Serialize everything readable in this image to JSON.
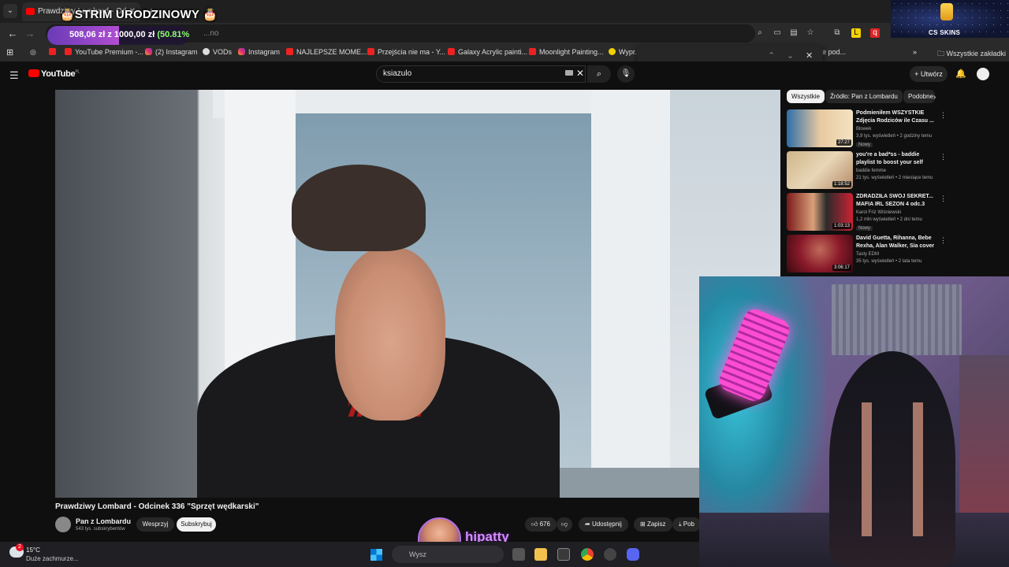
{
  "browser": {
    "tab_title": "Prawdziwy Lombard - Od...",
    "url": "youtube.com/watch?v=...BU2u",
    "url_suffix": "...no",
    "bookmarks": [
      {
        "label": "YouTube Premium -...",
        "icon": "youtube-icon"
      },
      {
        "label": "(2) Instagram",
        "icon": "instagram-icon"
      },
      {
        "label": "VODs",
        "icon": "vods-icon"
      },
      {
        "label": "Instagram",
        "icon": "instagram-icon"
      },
      {
        "label": "NAJLEPSZE MOME...",
        "icon": "youtube-icon"
      },
      {
        "label": "Przejścia nie ma - Y...",
        "icon": "youtube-icon"
      },
      {
        "label": "Galaxy Acrylic painti...",
        "icon": "youtube-icon"
      },
      {
        "label": "Moonlight Painting...",
        "icon": "youtube-icon"
      },
      {
        "label": "Wypr...",
        "icon": "bulb-icon"
      },
      {
        "label": "e pod...",
        "icon": ""
      }
    ],
    "all_bookmarks": "Wszystkie zakładki"
  },
  "overlay": {
    "stream_title": "🎂STRIM URODZINOWY 🎂",
    "goal_text": "508,06 zł z 1000,00 zł",
    "goal_percent_label": "(50.81%)",
    "goal_fraction": 0.5081,
    "sponsor": "CS SKINS",
    "streamer_name": "hipatty"
  },
  "youtube": {
    "logo": "YouTube",
    "logo_region": "PL",
    "search_value": "ksiazulo",
    "create_label": "Utwórz",
    "video": {
      "title": "Prawdziwy Lombard - Odcinek 336 \"Sprzęt wędkarski\"",
      "channel": "Pan z Lombardu",
      "subscribers": "543 tys. subskrybentów",
      "support_label": "Wesprzyj",
      "subscribe_label": "Subskrybuj",
      "likes": "676",
      "share_label": "Udostępnij",
      "save_label": "Zapisz",
      "download_label": "Pob"
    },
    "chips": [
      "Wszystkie",
      "Źródło: Pan z Lombardu",
      "Podobne"
    ],
    "recommendations": [
      {
        "title": "Podmieniłem WSZYSTKIE Zdjęcia Rodziców ile Czasu ...",
        "channel": "Blowek",
        "meta": "3,9 tys. wyświetleń • 2 godziny temu",
        "badge": "Nowy",
        "duration": "27:27"
      },
      {
        "title": "you're a bad*ss - baddie playlist to boost your self confidence",
        "channel": "baddie femme",
        "meta": "21 tys. wyświetleń • 2 miesiące temu",
        "badge": "",
        "duration": "1:18:52"
      },
      {
        "title": "ZDRADZIŁA SWÓJ SEKRET... MAFIA IRL SEZON 4 odc.3",
        "channel": "Karol Friz Wiśniewski",
        "meta": "1,2 mln wyświetleń • 2 dni temu",
        "badge": "Nowy",
        "duration": "1:03:13"
      },
      {
        "title": "David Guetta, Rihanna, Bebe Rexha, Alan Walker, Sia cover ...",
        "channel": "Tasty EDM",
        "meta": "35 tys. wyświetleń • 2 lata temu",
        "badge": "",
        "duration": "3:06:17"
      }
    ]
  },
  "taskbar": {
    "weather_temp": "15°C",
    "weather_desc": "Duże zachmurze...",
    "notifications": "2",
    "search_placeholder": "Wysz"
  }
}
